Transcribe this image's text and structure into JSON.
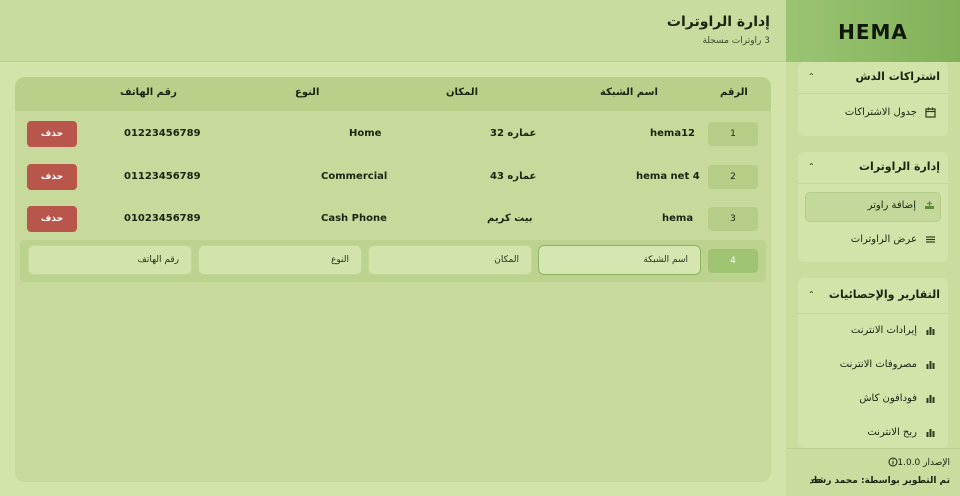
{
  "header": {
    "title": "إدارة الراوترات",
    "subtitle": "3 راوترات مسجلة"
  },
  "table": {
    "headers": {
      "num": "الرقم",
      "network": "اسم الشبكة",
      "location": "المكان",
      "type": "النوع",
      "phone": "رقم الهاتف"
    },
    "rows": [
      {
        "num": "1",
        "network": "hema12",
        "location": "عماره 32",
        "type": "Home",
        "phone": "01223456789",
        "delete": "حذف"
      },
      {
        "num": "2",
        "network": "hema net 4",
        "location": "عماره 43",
        "type": "Commercial",
        "phone": "01123456789",
        "delete": "حذف"
      },
      {
        "num": "3",
        "network": "hema",
        "location": "بيت كريم",
        "type": "Cash Phone",
        "phone": "01023456789",
        "delete": "حذف"
      }
    ],
    "add_row": {
      "num": "4",
      "network_placeholder": "اسم الشبكة",
      "location_placeholder": "المكان",
      "type_placeholder": "النوع",
      "phone_placeholder": "رقم الهاتف"
    }
  },
  "sidebar": {
    "brand": "HEMA",
    "groups": [
      {
        "title": "اشتراكات الدش",
        "items": [
          {
            "label": "جدول الاشتراكات",
            "icon": "calendar-icon"
          }
        ]
      },
      {
        "title": "إدارة الراوترات",
        "items": [
          {
            "label": "إضافة راوتر",
            "icon": "add-router-icon",
            "active": true
          },
          {
            "label": "عرض الراوترات",
            "icon": "list-icon"
          }
        ]
      },
      {
        "title": "التقارير والإحصائيات",
        "items": [
          {
            "label": "إيرادات الانترنت",
            "icon": "bar-chart-icon"
          },
          {
            "label": "مصروفات الانترنت",
            "icon": "bar-chart-icon"
          },
          {
            "label": "فودافون كاش",
            "icon": "bar-chart-icon"
          },
          {
            "label": "ربح الانترنت",
            "icon": "bar-chart-icon"
          }
        ]
      }
    ],
    "footer": {
      "version": "الإصدار 1.0.0",
      "developer": "تم التطوير بواسطة: محمد رشاد"
    }
  },
  "colors": {
    "accent": "#9bc472",
    "delete": "#b9564c",
    "background": "#d3e4ab"
  }
}
